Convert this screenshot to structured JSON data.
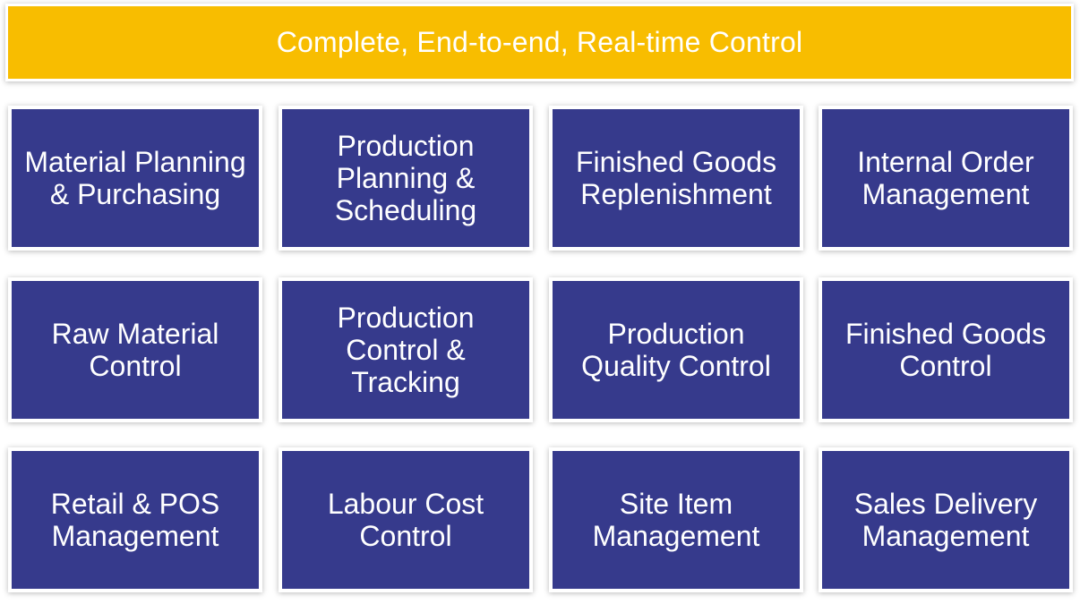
{
  "banner": {
    "title": "Complete, End-to-end, Real-time Control"
  },
  "tiles": [
    {
      "label": "Material Planning\n& Purchasing"
    },
    {
      "label": "Production\nPlanning &\nScheduling"
    },
    {
      "label": "Finished Goods\nReplenishment"
    },
    {
      "label": "Internal Order\nManagement"
    },
    {
      "label": "Raw Material\nControl"
    },
    {
      "label": "Production\nControl &\nTracking"
    },
    {
      "label": "Production\nQuality Control"
    },
    {
      "label": "Finished Goods\nControl"
    },
    {
      "label": "Retail & POS\nManagement"
    },
    {
      "label": "Labour Cost\nControl"
    },
    {
      "label": "Site Item\nManagement"
    },
    {
      "label": "Sales Delivery\nManagement"
    }
  ],
  "colors": {
    "banner": "#f8bd00",
    "tile": "#363a8c",
    "text": "#ffffff"
  }
}
